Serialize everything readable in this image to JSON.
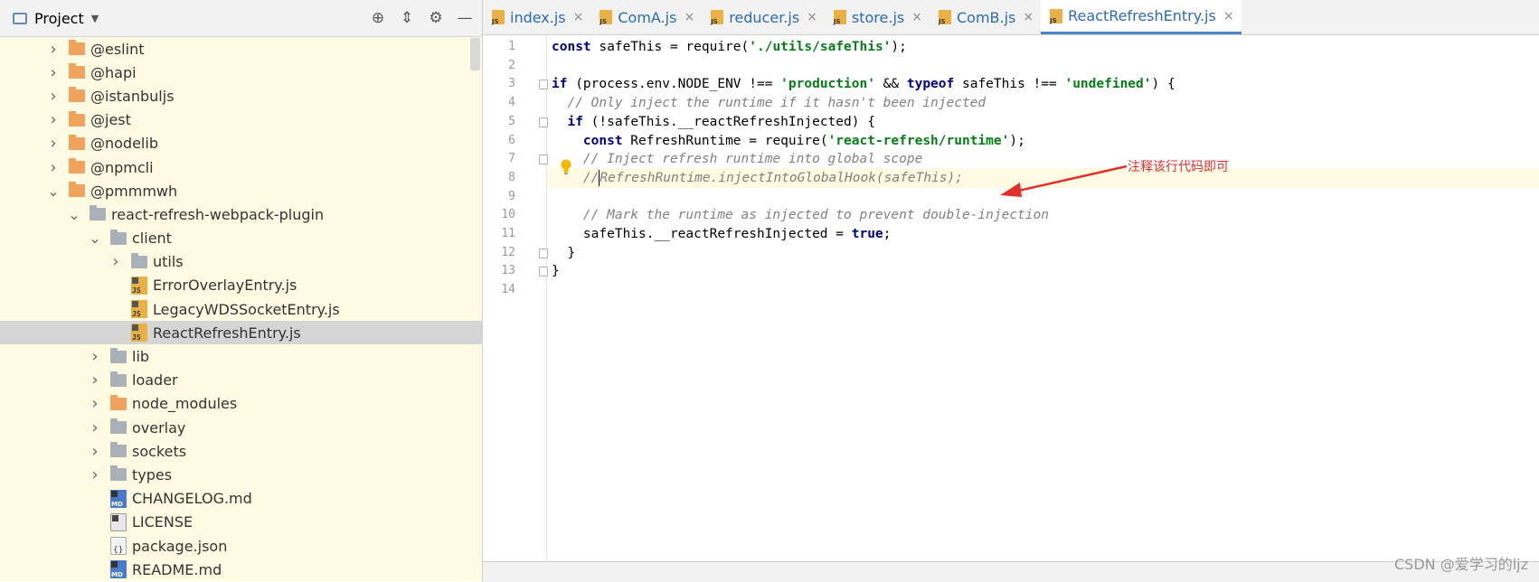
{
  "project_panel": {
    "title": "Project",
    "tree": [
      {
        "label": "@eslint",
        "type": "folder",
        "color": "orange",
        "depth": 2,
        "expanded": false
      },
      {
        "label": "@hapi",
        "type": "folder",
        "color": "orange",
        "depth": 2,
        "expanded": false
      },
      {
        "label": "@istanbuljs",
        "type": "folder",
        "color": "orange",
        "depth": 2,
        "expanded": false
      },
      {
        "label": "@jest",
        "type": "folder",
        "color": "orange",
        "depth": 2,
        "expanded": false
      },
      {
        "label": "@nodelib",
        "type": "folder",
        "color": "orange",
        "depth": 2,
        "expanded": false
      },
      {
        "label": "@npmcli",
        "type": "folder",
        "color": "orange",
        "depth": 2,
        "expanded": false
      },
      {
        "label": "@pmmmwh",
        "type": "folder",
        "color": "orange",
        "depth": 2,
        "expanded": true
      },
      {
        "label": "react-refresh-webpack-plugin",
        "type": "folder",
        "color": "gray",
        "depth": 3,
        "expanded": true
      },
      {
        "label": "client",
        "type": "folder",
        "color": "gray",
        "depth": 4,
        "expanded": true
      },
      {
        "label": "utils",
        "type": "folder",
        "color": "gray",
        "depth": 5,
        "expanded": false
      },
      {
        "label": "ErrorOverlayEntry.js",
        "type": "js",
        "depth": 5
      },
      {
        "label": "LegacyWDSSocketEntry.js",
        "type": "js",
        "depth": 5
      },
      {
        "label": "ReactRefreshEntry.js",
        "type": "js",
        "depth": 5,
        "selected": true
      },
      {
        "label": "lib",
        "type": "folder",
        "color": "gray",
        "depth": 4,
        "expanded": false
      },
      {
        "label": "loader",
        "type": "folder",
        "color": "gray",
        "depth": 4,
        "expanded": false
      },
      {
        "label": "node_modules",
        "type": "folder",
        "color": "orange",
        "depth": 4,
        "expanded": false
      },
      {
        "label": "overlay",
        "type": "folder",
        "color": "gray",
        "depth": 4,
        "expanded": false
      },
      {
        "label": "sockets",
        "type": "folder",
        "color": "gray",
        "depth": 4,
        "expanded": false
      },
      {
        "label": "types",
        "type": "folder",
        "color": "gray",
        "depth": 4,
        "expanded": false
      },
      {
        "label": "CHANGELOG.md",
        "type": "md",
        "depth": 4
      },
      {
        "label": "LICENSE",
        "type": "lic",
        "depth": 4
      },
      {
        "label": "package.json",
        "type": "json",
        "depth": 4
      },
      {
        "label": "README.md",
        "type": "md",
        "depth": 4
      }
    ]
  },
  "tabs": [
    {
      "label": "index.js",
      "active": false
    },
    {
      "label": "ComA.js",
      "active": false
    },
    {
      "label": "reducer.js",
      "active": false
    },
    {
      "label": "store.js",
      "active": false
    },
    {
      "label": "ComB.js",
      "active": false
    },
    {
      "label": "ReactRefreshEntry.js",
      "active": true
    }
  ],
  "editor": {
    "line_numbers": [
      "1",
      "2",
      "3",
      "4",
      "5",
      "6",
      "7",
      "8",
      "9",
      "10",
      "11",
      "12",
      "13",
      "14"
    ],
    "lines": [
      [
        {
          "t": "const",
          "c": "kw"
        },
        {
          "t": " safeThis = require("
        },
        {
          "t": "'./utils/safeThis'",
          "c": "str"
        },
        {
          "t": ");"
        }
      ],
      [],
      [
        {
          "t": "if",
          "c": "kw"
        },
        {
          "t": " (process.env.NODE_ENV !== "
        },
        {
          "t": "'production'",
          "c": "str"
        },
        {
          "t": " && "
        },
        {
          "t": "typeof",
          "c": "kw"
        },
        {
          "t": " safeThis !== "
        },
        {
          "t": "'undefined'",
          "c": "str"
        },
        {
          "t": ") {"
        }
      ],
      [
        {
          "t": "  "
        },
        {
          "t": "// Only inject the runtime if it hasn't been injected",
          "c": "cmt"
        }
      ],
      [
        {
          "t": "  "
        },
        {
          "t": "if",
          "c": "kw"
        },
        {
          "t": " (!safeThis.__reactRefreshInjected) {"
        }
      ],
      [
        {
          "t": "    "
        },
        {
          "t": "const",
          "c": "kw"
        },
        {
          "t": " RefreshRuntime = require("
        },
        {
          "t": "'react-refresh/runtime'",
          "c": "str"
        },
        {
          "t": ");"
        }
      ],
      [
        {
          "t": "    "
        },
        {
          "t": "// Inject refresh runtime into global scope",
          "c": "cmt"
        }
      ],
      [
        {
          "t": "    "
        },
        {
          "t": "//",
          "c": "cmt"
        },
        {
          "t": "",
          "caret": true
        },
        {
          "t": "RefreshRuntime.injectIntoGlobalHook(safeThis);",
          "c": "cmt"
        }
      ],
      [],
      [
        {
          "t": "    "
        },
        {
          "t": "// Mark the runtime as injected to prevent double-injection",
          "c": "cmt"
        }
      ],
      [
        {
          "t": "    safeThis.__reactRefreshInjected = "
        },
        {
          "t": "true",
          "c": "kw"
        },
        {
          "t": ";"
        }
      ],
      [
        {
          "t": "  }"
        }
      ],
      [
        {
          "t": "}"
        }
      ],
      []
    ],
    "highlighted_line": 8
  },
  "annotation": {
    "text": "注释该行代码即可",
    "color": "#e0302a"
  },
  "watermark": "CSDN @爱学习的ljz"
}
